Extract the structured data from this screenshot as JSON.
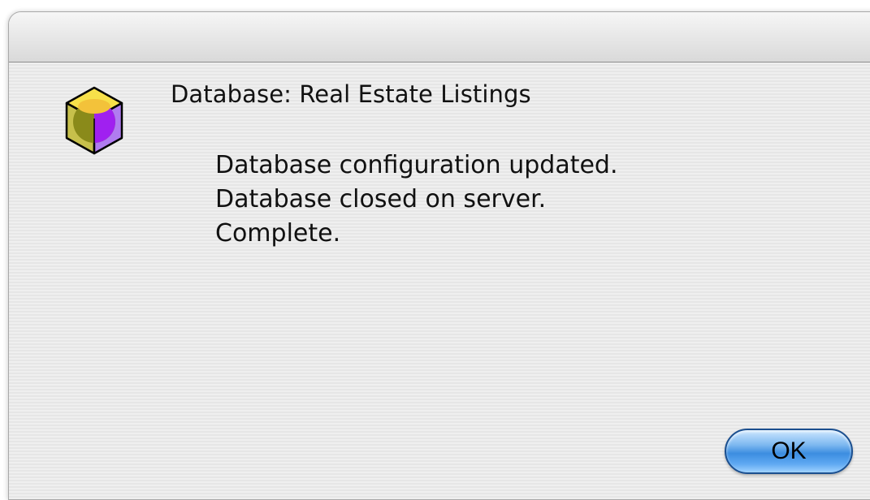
{
  "dialog": {
    "title": "Database: Real Estate Listings",
    "messages": [
      "Database configuration updated.",
      "Database closed on server.",
      "Complete."
    ],
    "ok_label": "OK"
  },
  "icons": {
    "app": "database-cube-icon"
  },
  "colors": {
    "ok_button": "#3c8de0",
    "icon_yellow": "#f7e04a",
    "icon_purple": "#a020f0"
  }
}
